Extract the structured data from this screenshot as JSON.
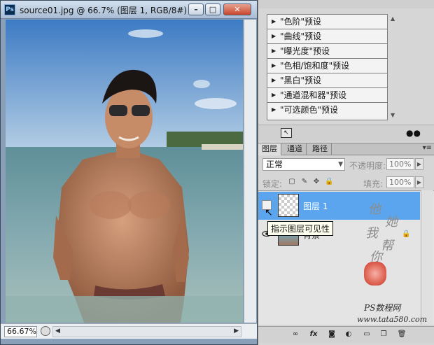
{
  "document": {
    "title": "source01.jpg @ 66.7% (图层 1, RGB/8#) *",
    "zoom": "66.67%",
    "app_icon": "Ps"
  },
  "adjustments": {
    "presets": [
      "\"色阶\"预设",
      "\"曲线\"预设",
      "\"曝光度\"预设",
      "\"色相/饱和度\"预设",
      "\"黑白\"预设",
      "\"通道混和器\"预设",
      "\"可选颜色\"预设"
    ]
  },
  "layers_panel": {
    "tabs": [
      "图层",
      "通道",
      "路径"
    ],
    "active_tab": "图层",
    "blend_mode": "正常",
    "opacity_label": "不透明度:",
    "opacity_value": "100%",
    "lock_label": "锁定:",
    "fill_label": "填充:",
    "fill_value": "100%",
    "layers": [
      {
        "name": "图层 1",
        "selected": true,
        "visible": false
      },
      {
        "name": "背景",
        "selected": false,
        "visible": true,
        "locked": true
      }
    ]
  },
  "tooltip": "指示图层可见性",
  "watermark": {
    "site": "PS数程网",
    "url": "www.tata580.com",
    "calligraphy": [
      "他",
      "她",
      "我",
      "帮",
      "你"
    ]
  },
  "colors": {
    "selection": "#5aa5ee",
    "panel_bg": "#d6d6d6",
    "titlebar": "#a9bdd5"
  }
}
